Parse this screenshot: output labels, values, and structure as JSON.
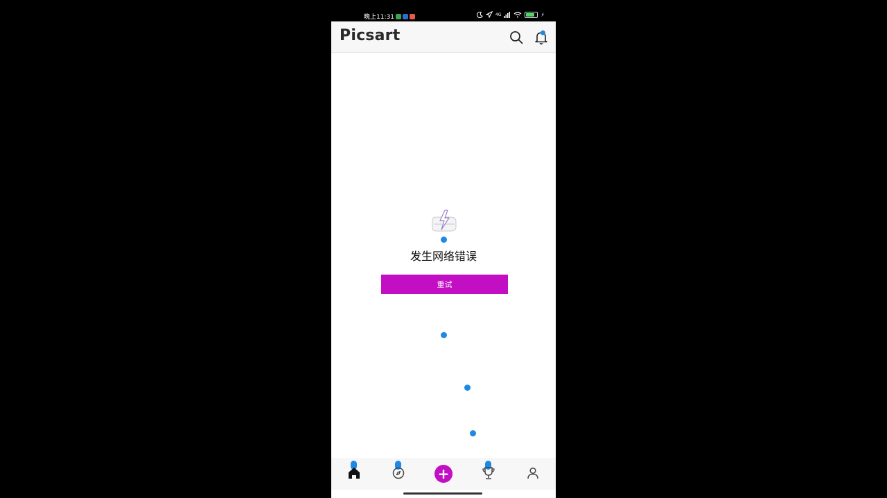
{
  "status_bar": {
    "time": "晚上11:31",
    "signal": "4G",
    "battery_color": "#4cd964"
  },
  "header": {
    "logo": "Picsart",
    "search_icon": "search-icon",
    "notification_icon": "bell-icon"
  },
  "content": {
    "error_message": "发生网络错误",
    "retry_label": "重试"
  },
  "bottom_nav": {
    "items": [
      {
        "name": "home",
        "icon": "home-icon"
      },
      {
        "name": "discover",
        "icon": "compass-icon"
      },
      {
        "name": "create",
        "icon": "plus-icon",
        "symbol": "+"
      },
      {
        "name": "challenges",
        "icon": "trophy-icon"
      },
      {
        "name": "profile",
        "icon": "user-icon"
      }
    ]
  },
  "colors": {
    "brand_accent": "#c20fc3",
    "indicator_blue": "#1e88e5",
    "header_bg": "#f7f7f7"
  }
}
